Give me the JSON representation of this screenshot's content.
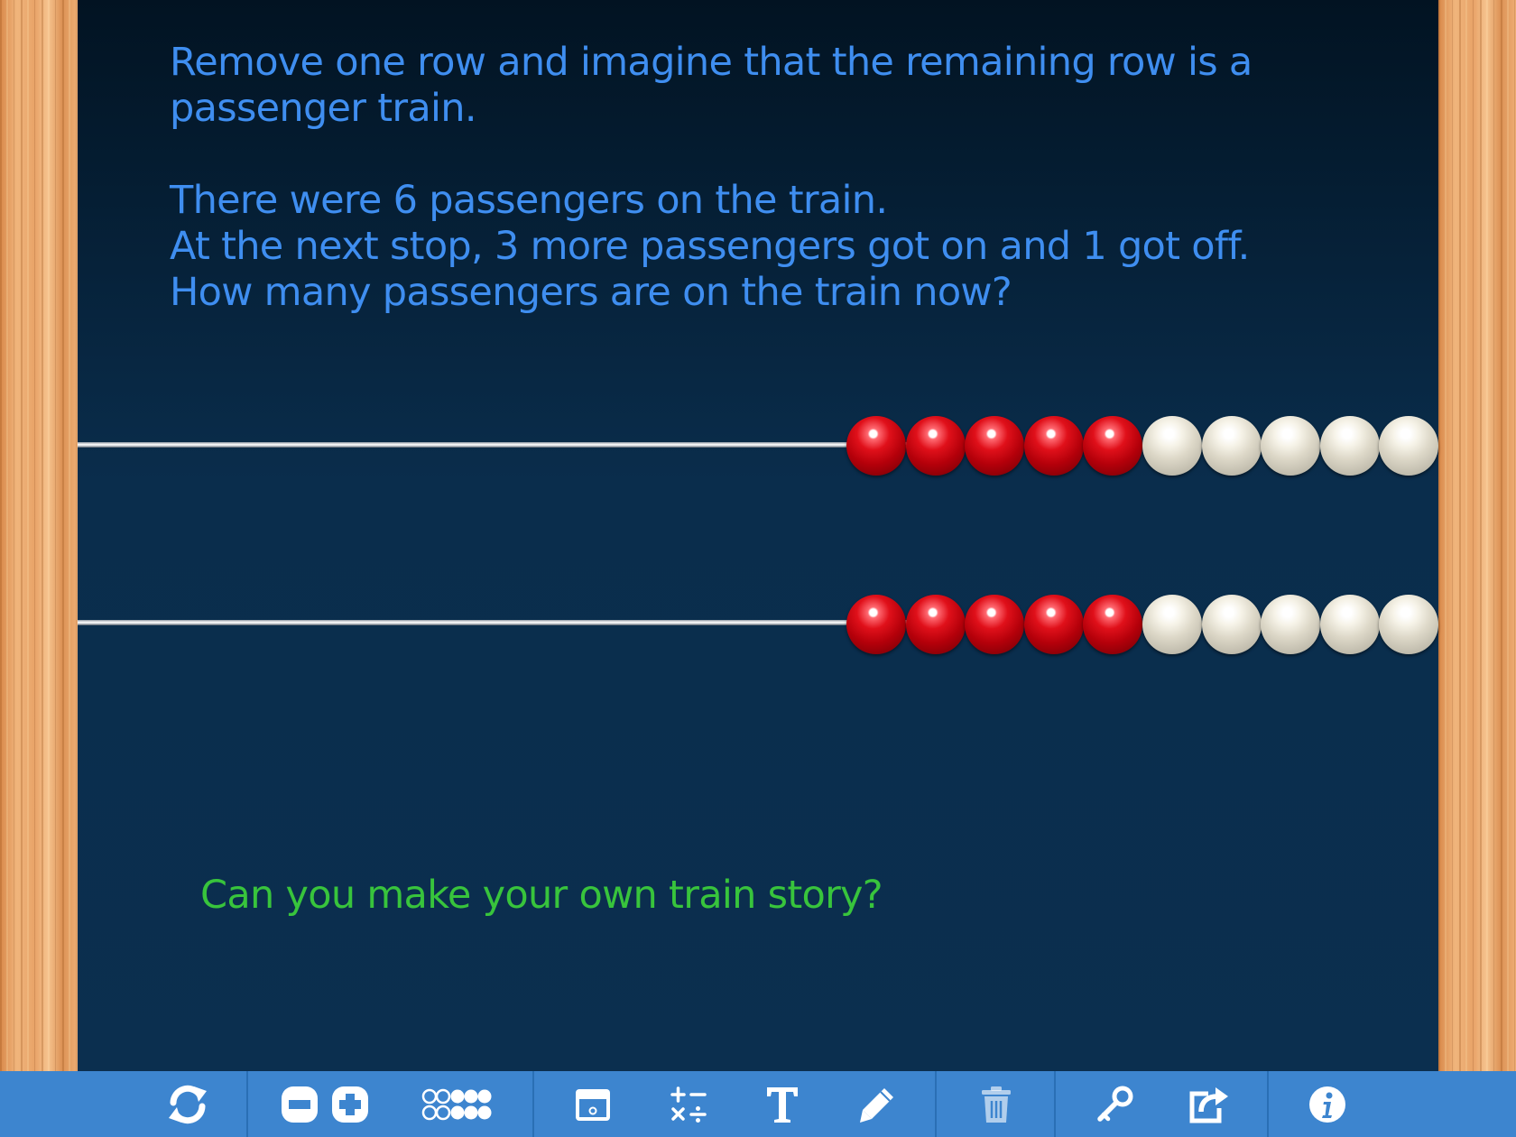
{
  "prompt": {
    "line1": "Remove one row and imagine that the remaining row is a",
    "line2": "passenger train.",
    "line3": "There were 6 passengers on the train.",
    "line4": "At the next stop, 3 more passengers got on and 1 got off.",
    "line5": "How many passengers are on the train now?"
  },
  "question": "Can you make your own train story?",
  "colors": {
    "prompt_text": "#3f8ef0",
    "question_text": "#38c43c",
    "bead_red": "#e0101a",
    "bead_white": "#f2efe4",
    "toolbar": "#3d85cf"
  },
  "rows": [
    {
      "red_beads": 5,
      "white_beads": 5
    },
    {
      "red_beads": 5,
      "white_beads": 5
    }
  ],
  "toolbar": {
    "icons": [
      "refresh-icon",
      "remove-row-icon",
      "add-row-icon",
      "bead-groups-icon",
      "tray-icon",
      "operations-icon",
      "text-icon",
      "pencil-icon",
      "trash-icon",
      "key-icon",
      "share-icon",
      "info-icon"
    ]
  }
}
